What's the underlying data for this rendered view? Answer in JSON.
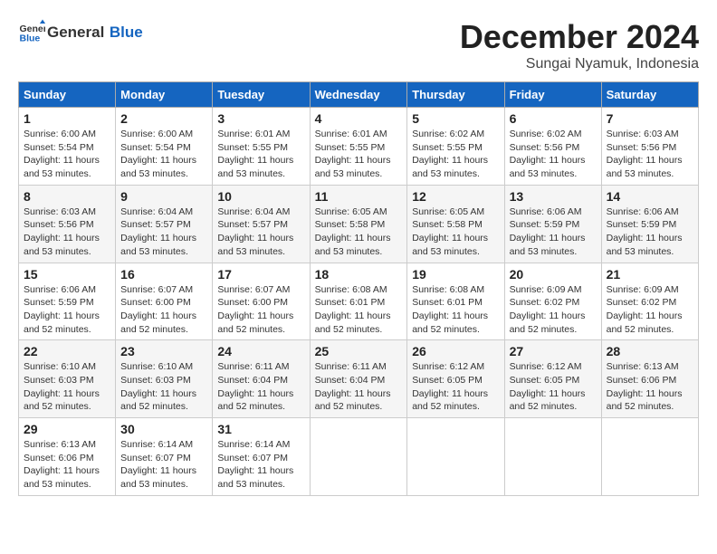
{
  "logo": {
    "general": "General",
    "blue": "Blue"
  },
  "title": "December 2024",
  "location": "Sungai Nyamuk, Indonesia",
  "days_of_week": [
    "Sunday",
    "Monday",
    "Tuesday",
    "Wednesday",
    "Thursday",
    "Friday",
    "Saturday"
  ],
  "weeks": [
    [
      {
        "day": "1",
        "sunrise": "6:00 AM",
        "sunset": "5:54 PM",
        "daylight": "11 hours and 53 minutes."
      },
      {
        "day": "2",
        "sunrise": "6:00 AM",
        "sunset": "5:54 PM",
        "daylight": "11 hours and 53 minutes."
      },
      {
        "day": "3",
        "sunrise": "6:01 AM",
        "sunset": "5:55 PM",
        "daylight": "11 hours and 53 minutes."
      },
      {
        "day": "4",
        "sunrise": "6:01 AM",
        "sunset": "5:55 PM",
        "daylight": "11 hours and 53 minutes."
      },
      {
        "day": "5",
        "sunrise": "6:02 AM",
        "sunset": "5:55 PM",
        "daylight": "11 hours and 53 minutes."
      },
      {
        "day": "6",
        "sunrise": "6:02 AM",
        "sunset": "5:56 PM",
        "daylight": "11 hours and 53 minutes."
      },
      {
        "day": "7",
        "sunrise": "6:03 AM",
        "sunset": "5:56 PM",
        "daylight": "11 hours and 53 minutes."
      }
    ],
    [
      {
        "day": "8",
        "sunrise": "6:03 AM",
        "sunset": "5:56 PM",
        "daylight": "11 hours and 53 minutes."
      },
      {
        "day": "9",
        "sunrise": "6:04 AM",
        "sunset": "5:57 PM",
        "daylight": "11 hours and 53 minutes."
      },
      {
        "day": "10",
        "sunrise": "6:04 AM",
        "sunset": "5:57 PM",
        "daylight": "11 hours and 53 minutes."
      },
      {
        "day": "11",
        "sunrise": "6:05 AM",
        "sunset": "5:58 PM",
        "daylight": "11 hours and 53 minutes."
      },
      {
        "day": "12",
        "sunrise": "6:05 AM",
        "sunset": "5:58 PM",
        "daylight": "11 hours and 53 minutes."
      },
      {
        "day": "13",
        "sunrise": "6:06 AM",
        "sunset": "5:59 PM",
        "daylight": "11 hours and 53 minutes."
      },
      {
        "day": "14",
        "sunrise": "6:06 AM",
        "sunset": "5:59 PM",
        "daylight": "11 hours and 53 minutes."
      }
    ],
    [
      {
        "day": "15",
        "sunrise": "6:06 AM",
        "sunset": "5:59 PM",
        "daylight": "11 hours and 52 minutes."
      },
      {
        "day": "16",
        "sunrise": "6:07 AM",
        "sunset": "6:00 PM",
        "daylight": "11 hours and 52 minutes."
      },
      {
        "day": "17",
        "sunrise": "6:07 AM",
        "sunset": "6:00 PM",
        "daylight": "11 hours and 52 minutes."
      },
      {
        "day": "18",
        "sunrise": "6:08 AM",
        "sunset": "6:01 PM",
        "daylight": "11 hours and 52 minutes."
      },
      {
        "day": "19",
        "sunrise": "6:08 AM",
        "sunset": "6:01 PM",
        "daylight": "11 hours and 52 minutes."
      },
      {
        "day": "20",
        "sunrise": "6:09 AM",
        "sunset": "6:02 PM",
        "daylight": "11 hours and 52 minutes."
      },
      {
        "day": "21",
        "sunrise": "6:09 AM",
        "sunset": "6:02 PM",
        "daylight": "11 hours and 52 minutes."
      }
    ],
    [
      {
        "day": "22",
        "sunrise": "6:10 AM",
        "sunset": "6:03 PM",
        "daylight": "11 hours and 52 minutes."
      },
      {
        "day": "23",
        "sunrise": "6:10 AM",
        "sunset": "6:03 PM",
        "daylight": "11 hours and 52 minutes."
      },
      {
        "day": "24",
        "sunrise": "6:11 AM",
        "sunset": "6:04 PM",
        "daylight": "11 hours and 52 minutes."
      },
      {
        "day": "25",
        "sunrise": "6:11 AM",
        "sunset": "6:04 PM",
        "daylight": "11 hours and 52 minutes."
      },
      {
        "day": "26",
        "sunrise": "6:12 AM",
        "sunset": "6:05 PM",
        "daylight": "11 hours and 52 minutes."
      },
      {
        "day": "27",
        "sunrise": "6:12 AM",
        "sunset": "6:05 PM",
        "daylight": "11 hours and 52 minutes."
      },
      {
        "day": "28",
        "sunrise": "6:13 AM",
        "sunset": "6:06 PM",
        "daylight": "11 hours and 52 minutes."
      }
    ],
    [
      {
        "day": "29",
        "sunrise": "6:13 AM",
        "sunset": "6:06 PM",
        "daylight": "11 hours and 53 minutes."
      },
      {
        "day": "30",
        "sunrise": "6:14 AM",
        "sunset": "6:07 PM",
        "daylight": "11 hours and 53 minutes."
      },
      {
        "day": "31",
        "sunrise": "6:14 AM",
        "sunset": "6:07 PM",
        "daylight": "11 hours and 53 minutes."
      },
      null,
      null,
      null,
      null
    ]
  ],
  "labels": {
    "sunrise": "Sunrise:",
    "sunset": "Sunset:",
    "daylight": "Daylight:"
  }
}
